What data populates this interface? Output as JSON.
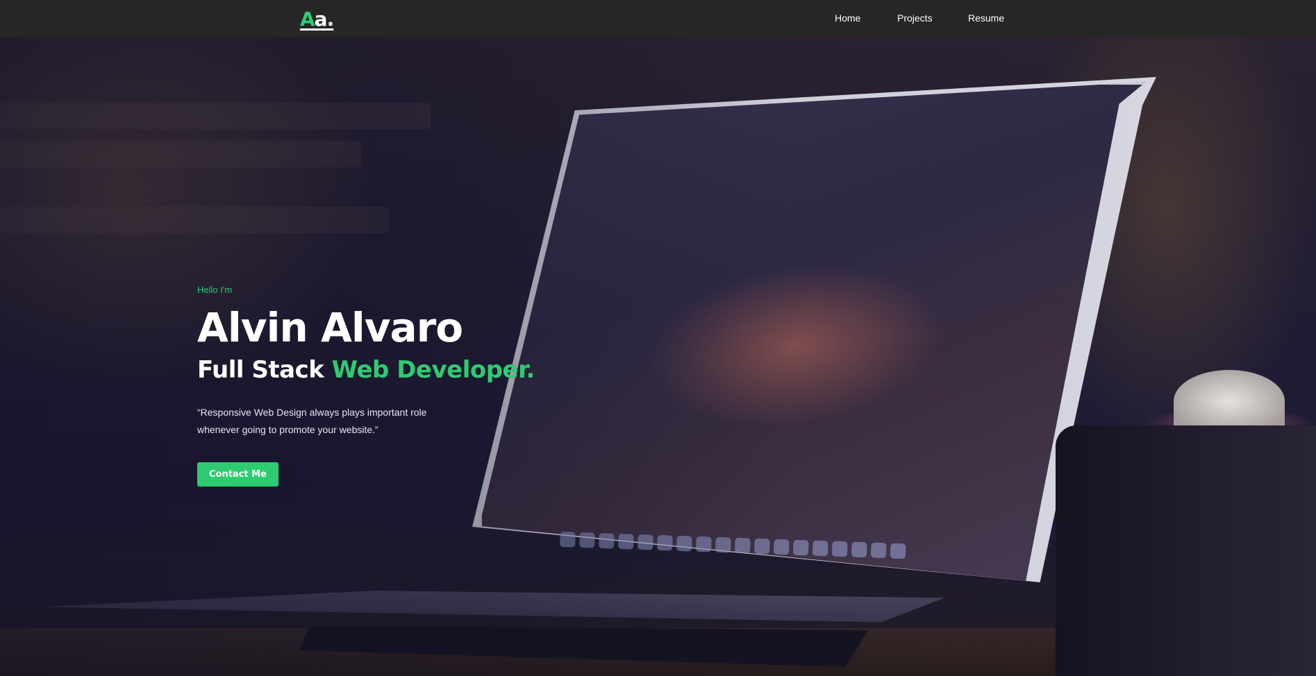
{
  "navbar": {
    "logo": {
      "letter": "A",
      "rest": "a."
    },
    "links": [
      {
        "label": "Home"
      },
      {
        "label": "Projects"
      },
      {
        "label": "Resume"
      }
    ]
  },
  "hero": {
    "greeting": "Hello I'm",
    "name": "Alvin Alvaro",
    "role_prefix": "Full Stack ",
    "role_accent": "Web Developer.",
    "quote": "“Responsive Web Design always plays important role whenever going to promote your website.”",
    "cta_label": "Contact Me"
  },
  "colors": {
    "accent": "#2ecc71",
    "navbar_bg": "#262626",
    "text": "#ffffff"
  }
}
